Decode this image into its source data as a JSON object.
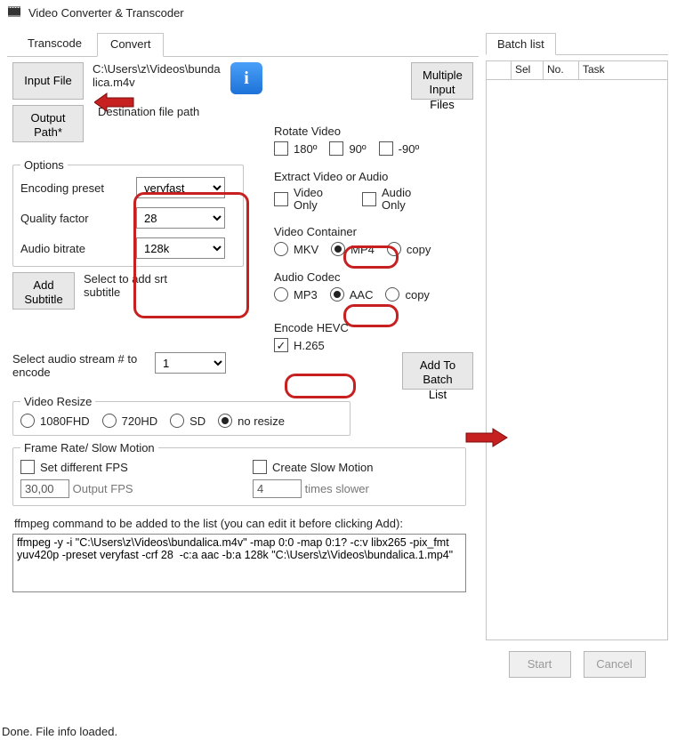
{
  "window": {
    "title": "Video Converter & Transcoder"
  },
  "tabs": {
    "transcode": "Transcode",
    "convert": "Convert",
    "active": "convert"
  },
  "batch": {
    "tab_label": "Batch list",
    "headers": {
      "sel": "Sel",
      "no": "No.",
      "task": "Task"
    },
    "start": "Start",
    "cancel": "Cancel"
  },
  "inputfile": {
    "button": "Input File",
    "path": "C:\\Users\\z\\Videos\\bundalica.m4v",
    "multiple_button": "Multiple\nInput Files"
  },
  "output": {
    "button": "Output\nPath*",
    "dest_label": "Destination file path"
  },
  "options": {
    "legend": "Options",
    "preset_label": "Encoding preset",
    "preset_value": "veryfast",
    "quality_label": "Quality factor",
    "quality_value": "28",
    "abitrate_label": "Audio bitrate",
    "abitrate_value": "128k"
  },
  "subtitle": {
    "button": "Add\nSubtitle",
    "label": "Select to add srt subtitle"
  },
  "rotate": {
    "title": "Rotate Video",
    "opt180": "180º",
    "opt90": "90º",
    "optm90": "-90º"
  },
  "extract": {
    "title": "Extract Video or Audio",
    "video_only": "Video\nOnly",
    "audio_only": "Audio\nOnly"
  },
  "container": {
    "title": "Video Container",
    "mkv": "MKV",
    "mp4": "MP4",
    "copy": "copy",
    "selected": "mp4"
  },
  "acodec": {
    "title": "Audio Codec",
    "mp3": "MP3",
    "aac": "AAC",
    "copy": "copy",
    "selected": "aac"
  },
  "hevc": {
    "title": "Encode HEVC",
    "label": "H.265",
    "checked": true
  },
  "audiostream": {
    "label": "Select audio stream # to encode",
    "value": "1"
  },
  "addbatch": {
    "button": "Add To\nBatch List"
  },
  "resize": {
    "legend": "Video Resize",
    "fhd": "1080FHD",
    "hd": "720HD",
    "sd": "SD",
    "none": "no resize",
    "selected": "none"
  },
  "framerate": {
    "legend": "Frame Rate/ Slow Motion",
    "set_fps_label": "Set different FPS",
    "create_slow_label": "Create Slow Motion",
    "fps_value": "30,00",
    "fps_hint": "Output FPS",
    "times_value": "4",
    "times_hint": "times slower"
  },
  "ffmpeg": {
    "label": "ffmpeg command to be added to the list (you can edit it before clicking Add):",
    "command": "ffmpeg -y -i \"C:\\Users\\z\\Videos\\bundalica.m4v\" -map 0:0 -map 0:1? -c:v libx265 -pix_fmt yuv420p -preset veryfast -crf 28  -c:a aac -b:a 128k \"C:\\Users\\z\\Videos\\bundalica.1.mp4\""
  },
  "status": "Done. File info loaded."
}
